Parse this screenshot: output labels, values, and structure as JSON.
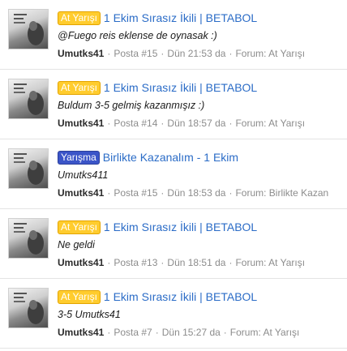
{
  "posts": [
    {
      "prefix": "At Yarışı",
      "prefix_type": "race",
      "title": "1 Ekim Sırasız İkili | BETABOL",
      "snippet": "@Fuego reis eklense de oynasak :)",
      "user": "Umutks41",
      "post_no": "Posta #15",
      "time": "Dün 21:53 da",
      "forum": "Forum: At Yarışı"
    },
    {
      "prefix": "At Yarışı",
      "prefix_type": "race",
      "title": "1 Ekim Sırasız İkili | BETABOL",
      "snippet": "Buldum 3-5 gelmiş kazanmışız :)",
      "user": "Umutks41",
      "post_no": "Posta #14",
      "time": "Dün 18:57 da",
      "forum": "Forum: At Yarışı"
    },
    {
      "prefix": "Yarışma",
      "prefix_type": "contest",
      "title": "Birlikte Kazanalım - 1 Ekim",
      "snippet": "Umutks411",
      "user": "Umutks41",
      "post_no": "Posta #15",
      "time": "Dün 18:53 da",
      "forum": "Forum: Birlikte Kazan"
    },
    {
      "prefix": "At Yarışı",
      "prefix_type": "race",
      "title": "1 Ekim Sırasız İkili | BETABOL",
      "snippet": "Ne geldi",
      "user": "Umutks41",
      "post_no": "Posta #13",
      "time": "Dün 18:51 da",
      "forum": "Forum: At Yarışı"
    },
    {
      "prefix": "At Yarışı",
      "prefix_type": "race",
      "title": "1 Ekim Sırasız İkili | BETABOL",
      "snippet": "3-5 Umutks41",
      "user": "Umutks41",
      "post_no": "Posta #7",
      "time": "Dün 15:27 da",
      "forum": "Forum: At Yarışı"
    }
  ],
  "separator": "·",
  "colors": {
    "link": "#2b6cc7",
    "prefix_race_bg": "#ffcc2e",
    "prefix_contest_bg": "#3b55c8",
    "meta_text": "#8c8c8c"
  }
}
